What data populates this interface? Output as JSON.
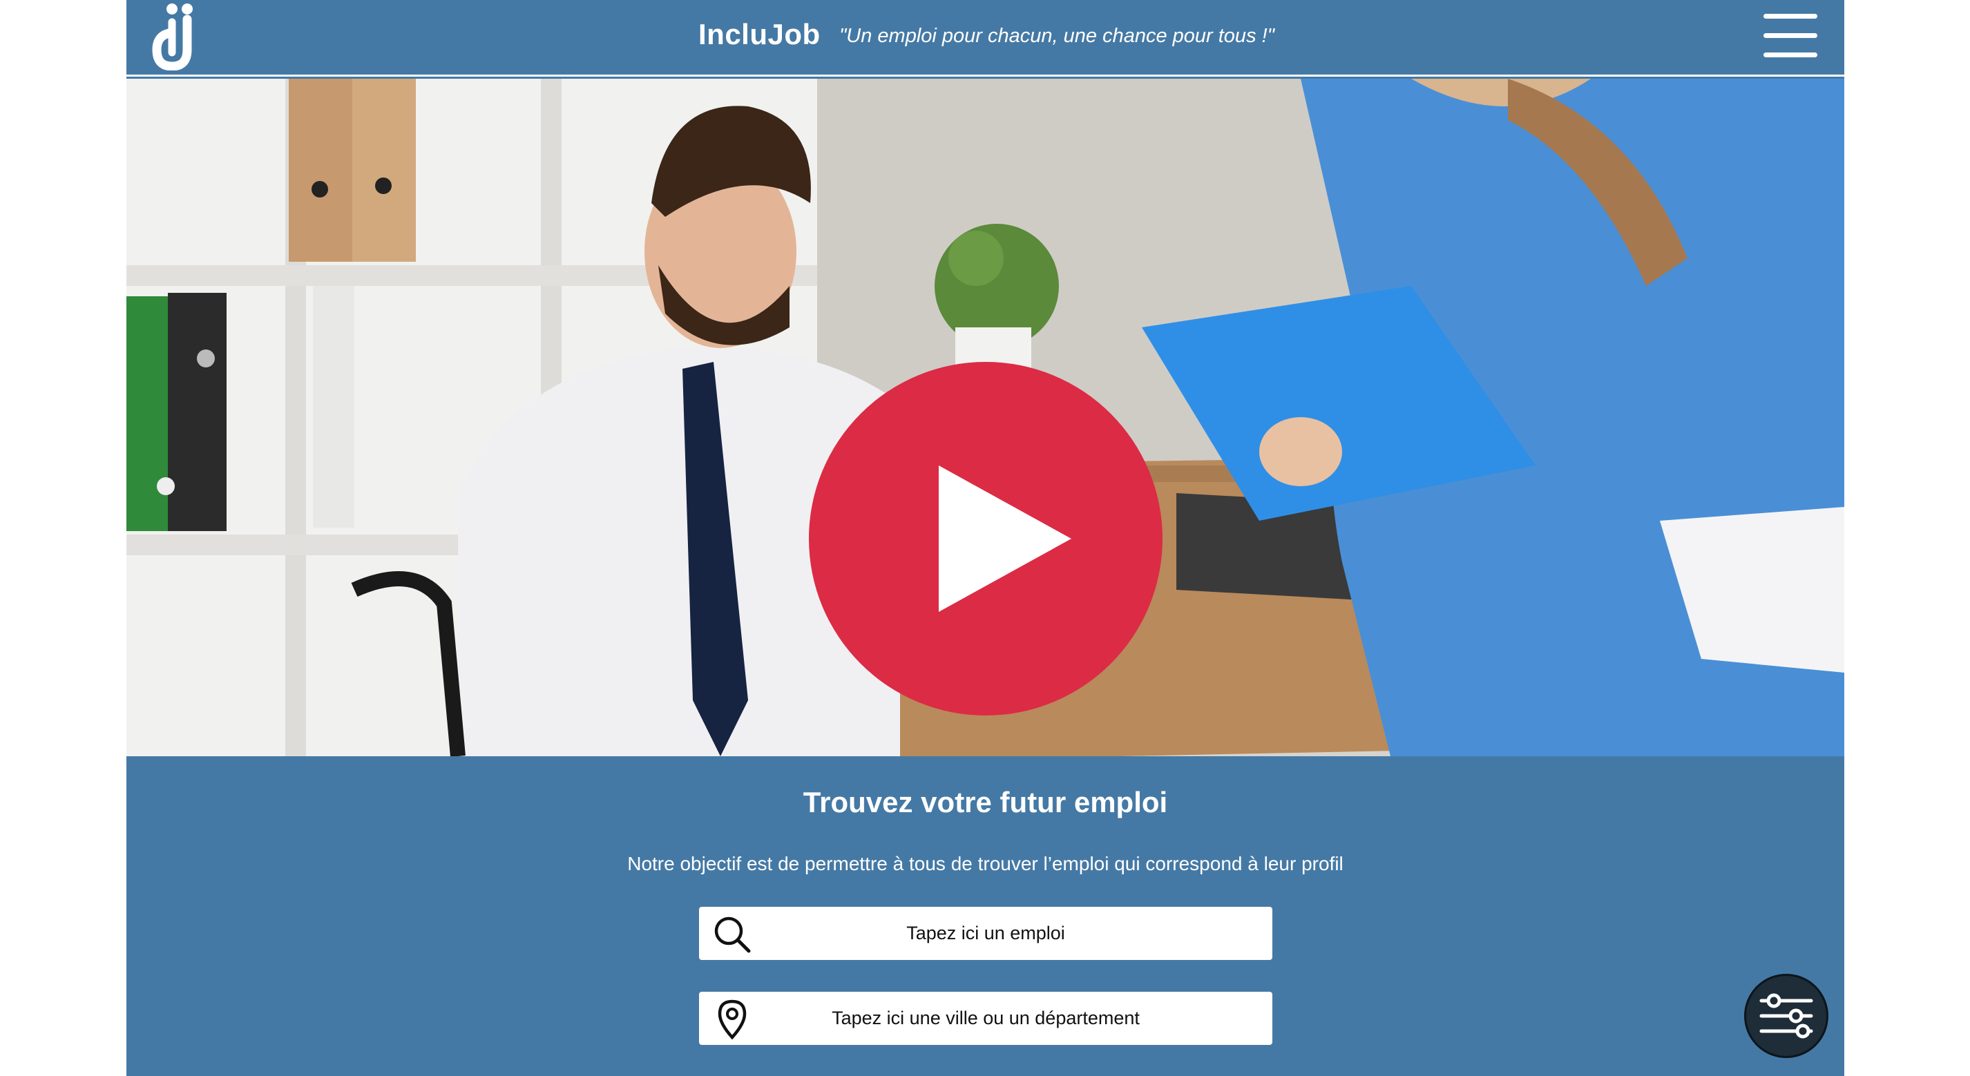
{
  "header": {
    "brand": "IncluJob",
    "tagline": "\"Un emploi pour chacun, une chance pour tous !\"",
    "logo_icon": "inclujob-logo-icon",
    "menu_icon": "hamburger-menu-icon"
  },
  "hero": {
    "image_description_icon": "hero-photo",
    "play_icon": "play-icon",
    "play_color": "#dc2b45"
  },
  "search": {
    "title": "Trouvez votre futur emploi",
    "subtitle": "Notre objectif est de permettre à tous de trouver l’emploi qui correspond à leur profil",
    "job_placeholder": "Tapez ici un emploi",
    "location_placeholder": "Tapez ici une ville ou un département",
    "job_icon": "search-icon",
    "location_icon": "map-pin-icon"
  },
  "accessibility": {
    "filter_icon": "settings-sliders-icon"
  },
  "colors": {
    "brand_blue": "#4579a5",
    "play_red": "#dc2b45",
    "filter_dark": "#1e2d38"
  }
}
